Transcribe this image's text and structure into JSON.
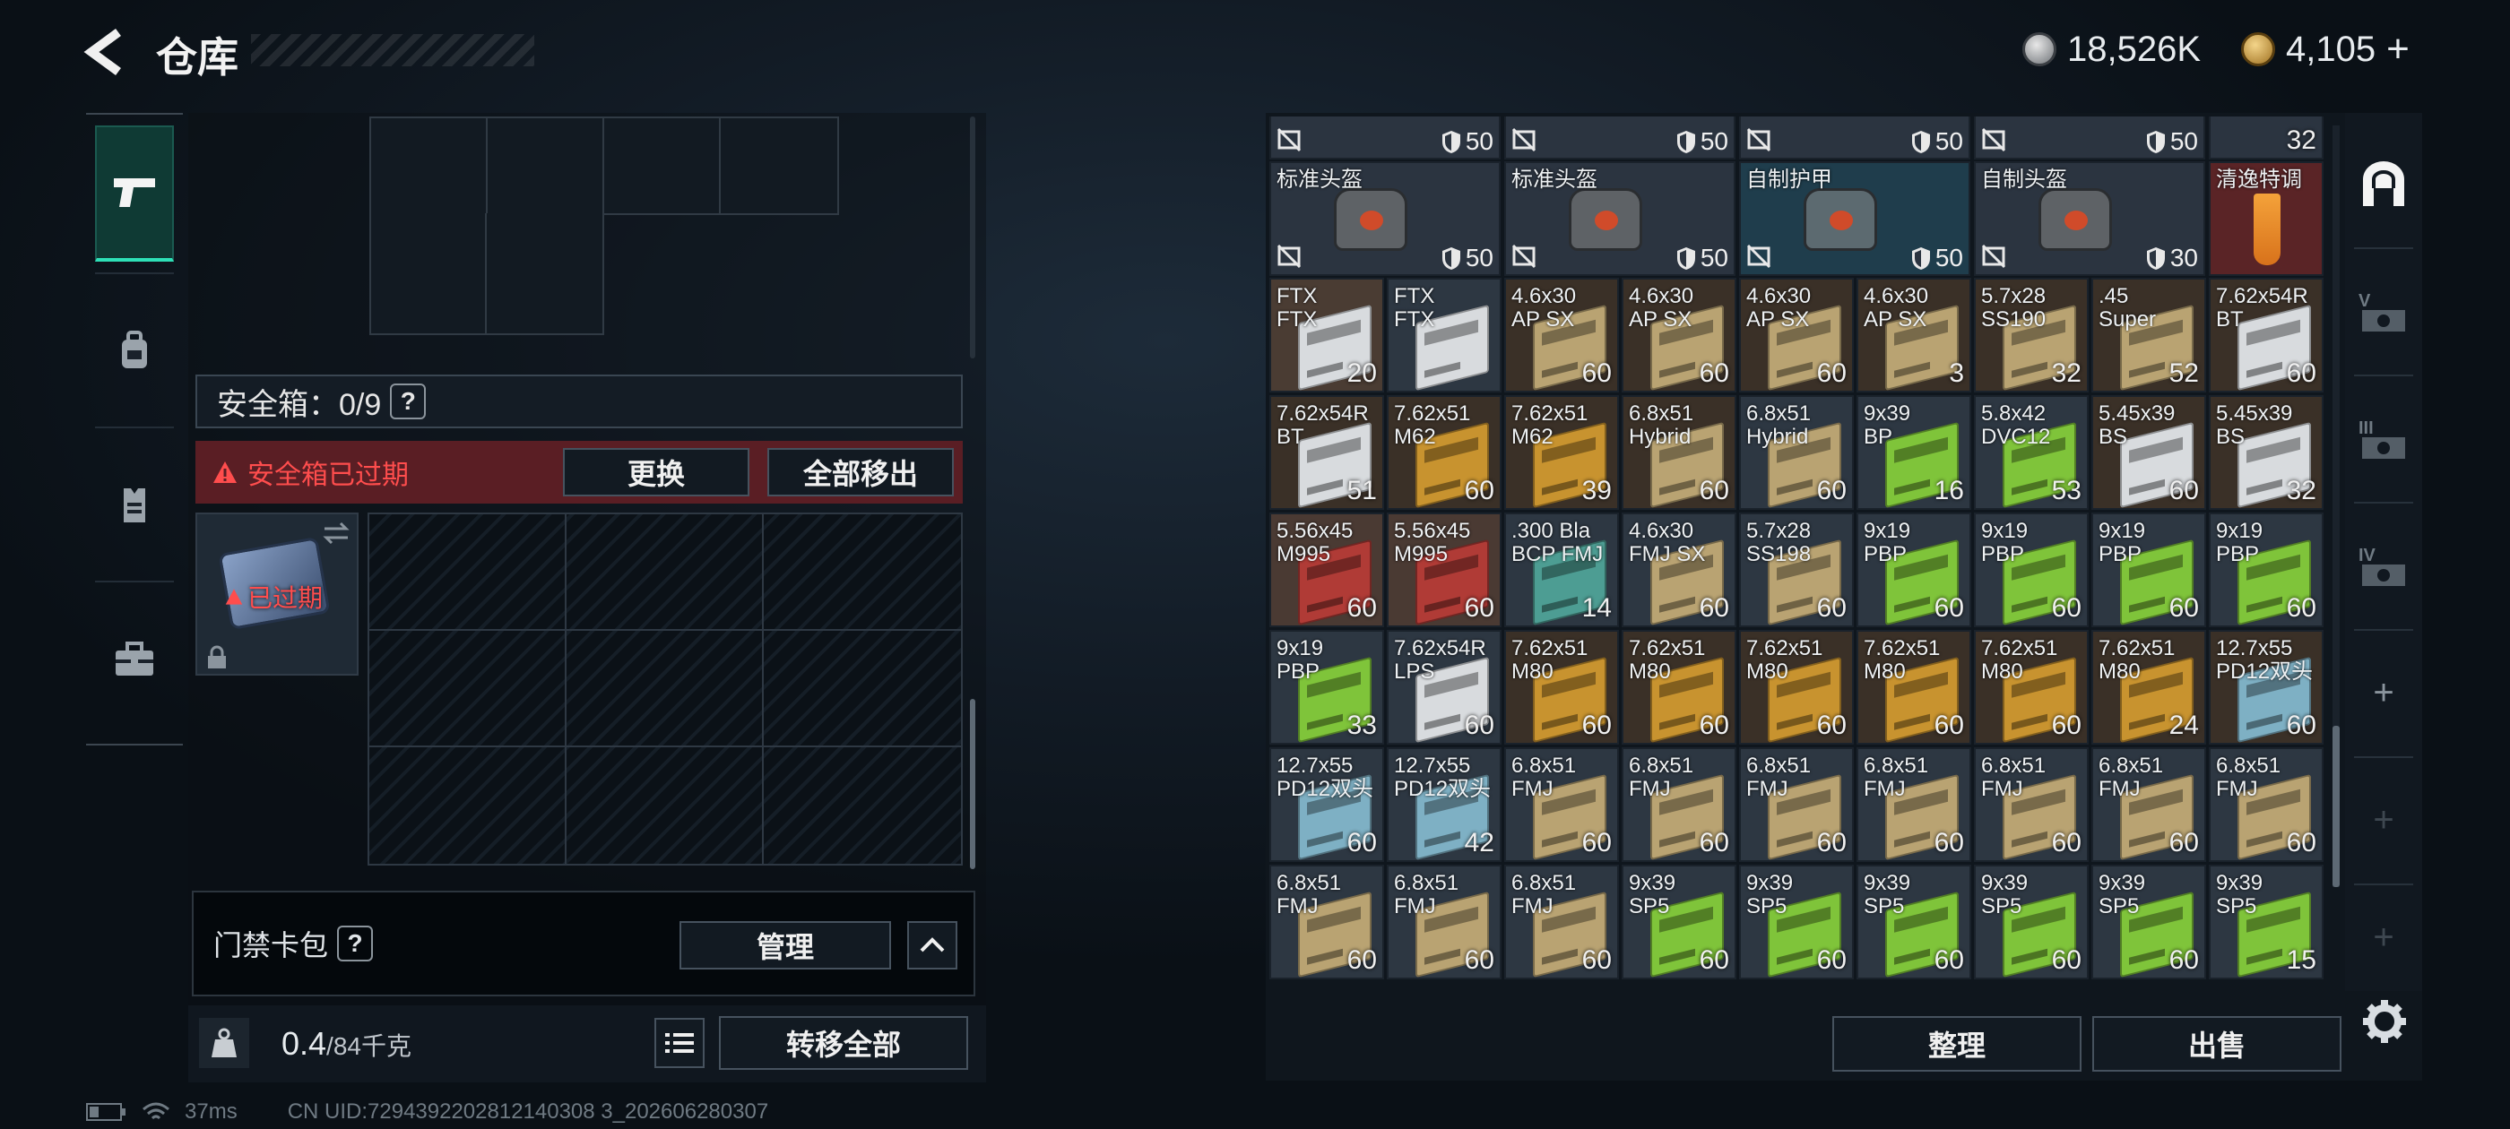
{
  "header": {
    "title": "仓库",
    "currency": [
      {
        "value": "18,526K",
        "icon": "silver-coin-icon"
      },
      {
        "value": "4,105",
        "icon": "gold-coin-icon",
        "suffix": "+"
      }
    ]
  },
  "left": {
    "safe_label": "安全箱：0/9",
    "safe_q": "?",
    "expired_text": "安全箱已过期",
    "replace_button": "更换",
    "move_all_out_button": "全部移出",
    "case_status": "已过期",
    "keypack_label": "门禁卡包",
    "keypack_q": "?",
    "manage_button": "管理",
    "weight_value": "0.4",
    "weight_cap": "/84千克",
    "transfer_all_button": "转移全部"
  },
  "right": {
    "sort_button": "整理",
    "sell_button": "出售"
  },
  "status": {
    "ping": "37ms",
    "uid": "CN UID:7294392202812140308 3_202606280307"
  },
  "colors": {
    "accent": "#2ee0b7",
    "danger": "#ff4d4d",
    "gold_box": "#c8932f",
    "green_box": "#7fc43a",
    "tan_box": "#b9a372",
    "white_box": "#d8dbde",
    "teal_box": "#4d9d93",
    "red_box": "#b03b36",
    "blue_box": "#7eb0c4",
    "bronze_box": "#a36a3a"
  },
  "inventory": [
    [
      {
        "name": "",
        "count": "",
        "type": "partial-helmet",
        "shield": "50"
      },
      {
        "name": "",
        "count": "",
        "type": "partial-helmet",
        "shield": "50"
      },
      {
        "name": "",
        "count": "",
        "type": "partial-helmet",
        "shield": "50"
      },
      {
        "name": "",
        "count": "",
        "type": "partial-helmet",
        "shield": "50"
      },
      {
        "name": "",
        "count": "32",
        "type": "partial-drink"
      }
    ],
    [
      {
        "name": "标准头盔",
        "type": "bag",
        "shield": "50",
        "bg": "#2b3440"
      },
      {
        "name": "标准头盔",
        "type": "bag",
        "shield": "50",
        "bg": "#2b3440"
      },
      {
        "name": "自制护甲",
        "type": "bag",
        "shield": "50",
        "bg": "#1f3d4c"
      },
      {
        "name": "自制头盔",
        "type": "bag",
        "shield": "30",
        "bg": "#2b3440"
      },
      {
        "name": "清逸特调",
        "type": "drink",
        "bg": "#5a2426"
      }
    ],
    [
      {
        "name": "FTX\nFTX",
        "count": "20",
        "color": "white_box",
        "bg": "#4a3c33"
      },
      {
        "name": "FTX\nFTX",
        "count": "",
        "color": "white_box",
        "bg": "#2d3742"
      },
      {
        "name": "4.6x30\nAP SX",
        "count": "60",
        "color": "tan_box",
        "bg": "#3a3027"
      },
      {
        "name": "4.6x30\nAP SX",
        "count": "60",
        "color": "tan_box",
        "bg": "#3a3027"
      },
      {
        "name": "4.6x30\nAP SX",
        "count": "60",
        "color": "tan_box",
        "bg": "#3a3027"
      },
      {
        "name": "4.6x30\nAP SX",
        "count": "3",
        "color": "tan_box",
        "bg": "#3a3027"
      },
      {
        "name": "5.7x28\nSS190",
        "count": "32",
        "color": "tan_box",
        "bg": "#3a3027"
      },
      {
        "name": ".45\nSuper",
        "count": "52",
        "color": "tan_box",
        "bg": "#3a3027"
      },
      {
        "name": "7.62x54R\nBT",
        "count": "60",
        "color": "white_box",
        "bg": "#3a3027"
      }
    ],
    [
      {
        "name": "7.62x54R\nBT",
        "count": "51",
        "color": "white_box",
        "bg": "#3a3027"
      },
      {
        "name": "7.62x51\nM62",
        "count": "60",
        "color": "gold_box",
        "bg": "#3a3027"
      },
      {
        "name": "7.62x51\nM62",
        "count": "39",
        "color": "gold_box",
        "bg": "#3a3027"
      },
      {
        "name": "6.8x51\nHybrid",
        "count": "60",
        "color": "tan_box",
        "bg": "#3a3027"
      },
      {
        "name": "6.8x51\nHybrid",
        "count": "60",
        "color": "tan_box",
        "bg": "#2d3742"
      },
      {
        "name": "9x39\nBP",
        "count": "16",
        "color": "green_box",
        "bg": "#2d3742"
      },
      {
        "name": "5.8x42\nDVC12",
        "count": "53",
        "color": "green_box",
        "bg": "#2d3742"
      },
      {
        "name": "5.45x39\nBS",
        "count": "60",
        "color": "white_box",
        "bg": "#3a3027"
      },
      {
        "name": "5.45x39\nBS",
        "count": "32",
        "color": "white_box",
        "bg": "#3a3027"
      }
    ],
    [
      {
        "name": "5.56x45\nM995",
        "count": "60",
        "color": "red_box",
        "bg": "#4a3a33"
      },
      {
        "name": "5.56x45\nM995",
        "count": "60",
        "color": "red_box",
        "bg": "#4a3a33"
      },
      {
        "name": ".300 Bla\nBCP FMJ",
        "count": "14",
        "color": "teal_box",
        "bg": "#2d3742"
      },
      {
        "name": "4.6x30\nFMJ SX",
        "count": "60",
        "color": "tan_box",
        "bg": "#2d3742"
      },
      {
        "name": "5.7x28\nSS198",
        "count": "60",
        "color": "tan_box",
        "bg": "#2d3742"
      },
      {
        "name": "9x19\nPBP",
        "count": "60",
        "color": "green_box",
        "bg": "#2d3742"
      },
      {
        "name": "9x19\nPBP",
        "count": "60",
        "color": "green_box",
        "bg": "#2d3742"
      },
      {
        "name": "9x19\nPBP",
        "count": "60",
        "color": "green_box",
        "bg": "#2d3742"
      },
      {
        "name": "9x19\nPBP",
        "count": "60",
        "color": "green_box",
        "bg": "#2d3742"
      }
    ],
    [
      {
        "name": "9x19\nPBP",
        "count": "33",
        "color": "green_box",
        "bg": "#2d3742"
      },
      {
        "name": "7.62x54R\nLPS",
        "count": "60",
        "color": "white_box",
        "bg": "#2d3742"
      },
      {
        "name": "7.62x51\nM80",
        "count": "60",
        "color": "gold_box",
        "bg": "#3a3027"
      },
      {
        "name": "7.62x51\nM80",
        "count": "60",
        "color": "gold_box",
        "bg": "#3a3027"
      },
      {
        "name": "7.62x51\nM80",
        "count": "60",
        "color": "gold_box",
        "bg": "#3a3027"
      },
      {
        "name": "7.62x51\nM80",
        "count": "60",
        "color": "gold_box",
        "bg": "#3a3027"
      },
      {
        "name": "7.62x51\nM80",
        "count": "60",
        "color": "gold_box",
        "bg": "#3a3027"
      },
      {
        "name": "7.62x51\nM80",
        "count": "24",
        "color": "gold_box",
        "bg": "#3a3027"
      },
      {
        "name": "12.7x55\nPD12双头",
        "count": "60",
        "color": "blue_box",
        "bg": "#3a3027"
      }
    ],
    [
      {
        "name": "12.7x55\nPD12双头",
        "count": "60",
        "color": "blue_box",
        "bg": "#2d3742"
      },
      {
        "name": "12.7x55\nPD12双头",
        "count": "42",
        "color": "blue_box",
        "bg": "#2d3742"
      },
      {
        "name": "6.8x51\nFMJ",
        "count": "60",
        "color": "tan_box",
        "bg": "#2d3742"
      },
      {
        "name": "6.8x51\nFMJ",
        "count": "60",
        "color": "tan_box",
        "bg": "#2d3742"
      },
      {
        "name": "6.8x51\nFMJ",
        "count": "60",
        "color": "tan_box",
        "bg": "#2d3742"
      },
      {
        "name": "6.8x51\nFMJ",
        "count": "60",
        "color": "tan_box",
        "bg": "#2d3742"
      },
      {
        "name": "6.8x51\nFMJ",
        "count": "60",
        "color": "tan_box",
        "bg": "#2d3742"
      },
      {
        "name": "6.8x51\nFMJ",
        "count": "60",
        "color": "tan_box",
        "bg": "#2d3742"
      },
      {
        "name": "6.8x51\nFMJ",
        "count": "60",
        "color": "tan_box",
        "bg": "#2d3742"
      }
    ],
    [
      {
        "name": "6.8x51\nFMJ",
        "count": "60",
        "color": "tan_box",
        "bg": "#2d3742"
      },
      {
        "name": "6.8x51\nFMJ",
        "count": "60",
        "color": "tan_box",
        "bg": "#2d3742"
      },
      {
        "name": "6.8x51\nFMJ",
        "count": "60",
        "color": "tan_box",
        "bg": "#2d3742"
      },
      {
        "name": "9x39\nSP5",
        "count": "60",
        "color": "green_box",
        "bg": "#2d3742"
      },
      {
        "name": "9x39\nSP5",
        "count": "60",
        "color": "green_box",
        "bg": "#2d3742"
      },
      {
        "name": "9x39\nSP5",
        "count": "60",
        "color": "green_box",
        "bg": "#2d3742"
      },
      {
        "name": "9x39\nSP5",
        "count": "60",
        "color": "green_box",
        "bg": "#2d3742"
      },
      {
        "name": "9x39\nSP5",
        "count": "60",
        "color": "green_box",
        "bg": "#2d3742"
      },
      {
        "name": "9x39\nSP5",
        "count": "15",
        "color": "green_box",
        "bg": "#2d3742"
      }
    ]
  ],
  "side_icons": [
    "pistol-icon",
    "backpack-icon",
    "vest-icon",
    "toolbox-icon"
  ],
  "rail_icons": [
    "stash-arch-icon",
    "stash-v-icon",
    "stash-iii-icon",
    "stash-iv-icon",
    "plus-icon",
    "plus-icon",
    "plus-icon",
    "gear-icon"
  ]
}
